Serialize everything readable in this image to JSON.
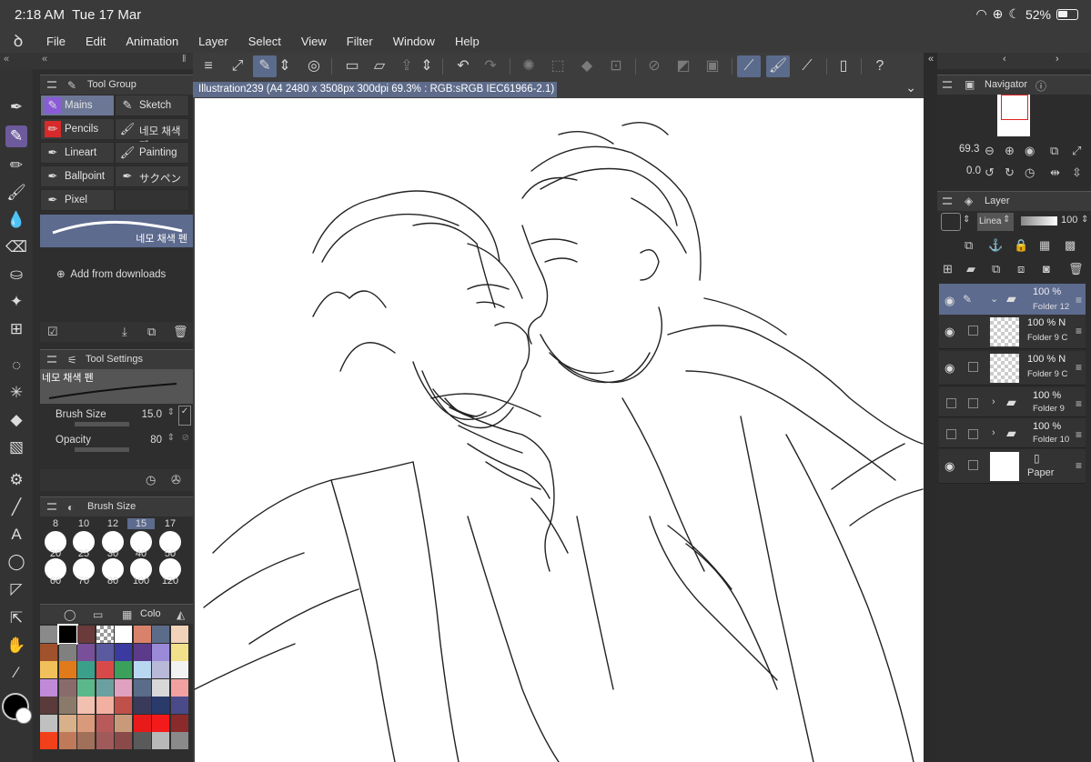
{
  "status": {
    "time": "2:18 AM",
    "date": "Tue 17 Mar",
    "battery": "52%"
  },
  "menu": [
    "File",
    "Edit",
    "Animation",
    "Layer",
    "Select",
    "View",
    "Filter",
    "Window",
    "Help"
  ],
  "document": {
    "tab": "Illustration239 (A4 2480 x 3508px 300dpi 69.3% : RGB:sRGB IEC61966-2.1)"
  },
  "tool_group": {
    "title": "Tool Group",
    "items": [
      {
        "label": "Mains",
        "icon": "pen-icon",
        "selected": true
      },
      {
        "label": "Sketch",
        "icon": "pencil-icon"
      },
      {
        "label": "Pencils",
        "icon": "pencil-red-icon"
      },
      {
        "label": "네모 채색 펜",
        "icon": "brush-icon"
      },
      {
        "label": "Lineart",
        "icon": "pen-icon"
      },
      {
        "label": "Painting",
        "icon": "brush-icon"
      },
      {
        "label": "Ballpoint",
        "icon": "pen-icon"
      },
      {
        "label": "サクペン",
        "icon": "pen-icon"
      },
      {
        "label": "Pixel",
        "icon": "pen-icon"
      }
    ],
    "current_brush": "네모 채색 펜",
    "add_downloads": "Add from downloads"
  },
  "tool_settings": {
    "title": "Tool Settings",
    "brush_name": "네모 채색 펜",
    "brush_size_label": "Brush Size",
    "brush_size_value": "15.0",
    "opacity_label": "Opacity",
    "opacity_value": "80"
  },
  "brush_size": {
    "title": "Brush Size",
    "top_row": [
      "8",
      "10",
      "12",
      "15",
      "17"
    ],
    "row1": [
      "20",
      "25",
      "30",
      "40",
      "50"
    ],
    "row2": [
      "60",
      "70",
      "80",
      "100",
      "120"
    ]
  },
  "color_panel": {
    "tab_label": "Colo",
    "swatches": [
      "#8a8a8a",
      "#000000",
      "#6b3b3b",
      "checker",
      "#ffffff",
      "#d9826b",
      "#5b6b8a",
      "#f2d2b8",
      "#a0522d",
      "#808080",
      "#7a4f9a",
      "#5a5aa0",
      "#3a3aa0",
      "#5b3b8a",
      "#9a8ad8",
      "#f2e08a",
      "#f2c05b",
      "#e07a1a",
      "#3aa08a",
      "#d84a4a",
      "#3aa05b",
      "#b8d8f2",
      "#b8b8d8",
      "#f2f2f2",
      "#c08ad8",
      "#8a6b6b",
      "#5bb88a",
      "#6ba0a0",
      "#e0a0c0",
      "#5b6b8a",
      "#d8d8d8",
      "#f2a0a0",
      "#5a3a3a",
      "#8a7a6a",
      "#f2c0b0",
      "#f2b0a0",
      "#c0504a",
      "#3a3a5a",
      "#2a3a6a",
      "#4a4a8a",
      "#c0c0c0",
      "#d8b08a",
      "#d89a7a",
      "#b85a5a",
      "#c89a7a",
      "#e81a1a",
      "#f21a1a",
      "#8a2a2a",
      "#f2401a",
      "#c07a5a",
      "#a0705a",
      "#a05a5a",
      "#8a4a4a",
      "#5a5a5a",
      "#b8b8b8",
      "#8a8a8a"
    ]
  },
  "navigator": {
    "title": "Navigator",
    "zoom": "69.3",
    "rotation": "0.0"
  },
  "layer_panel": {
    "title": "Layer",
    "blend": "Linea",
    "opacity": "100",
    "layers": [
      {
        "opacity": "100 %",
        "name": "Folder 12",
        "type": "folder",
        "selected": true,
        "visible": true
      },
      {
        "opacity": "100 % N",
        "name": "Folder 9 C",
        "type": "raster",
        "visible": true
      },
      {
        "opacity": "100 % N",
        "name": "Folder 9 C",
        "type": "raster",
        "visible": true
      },
      {
        "opacity": "100 %",
        "name": "Folder 9",
        "type": "folder",
        "visible": false
      },
      {
        "opacity": "100 %",
        "name": "Folder 10",
        "type": "folder",
        "visible": false
      },
      {
        "opacity": "",
        "name": "Paper",
        "type": "paper",
        "visible": true
      }
    ]
  }
}
